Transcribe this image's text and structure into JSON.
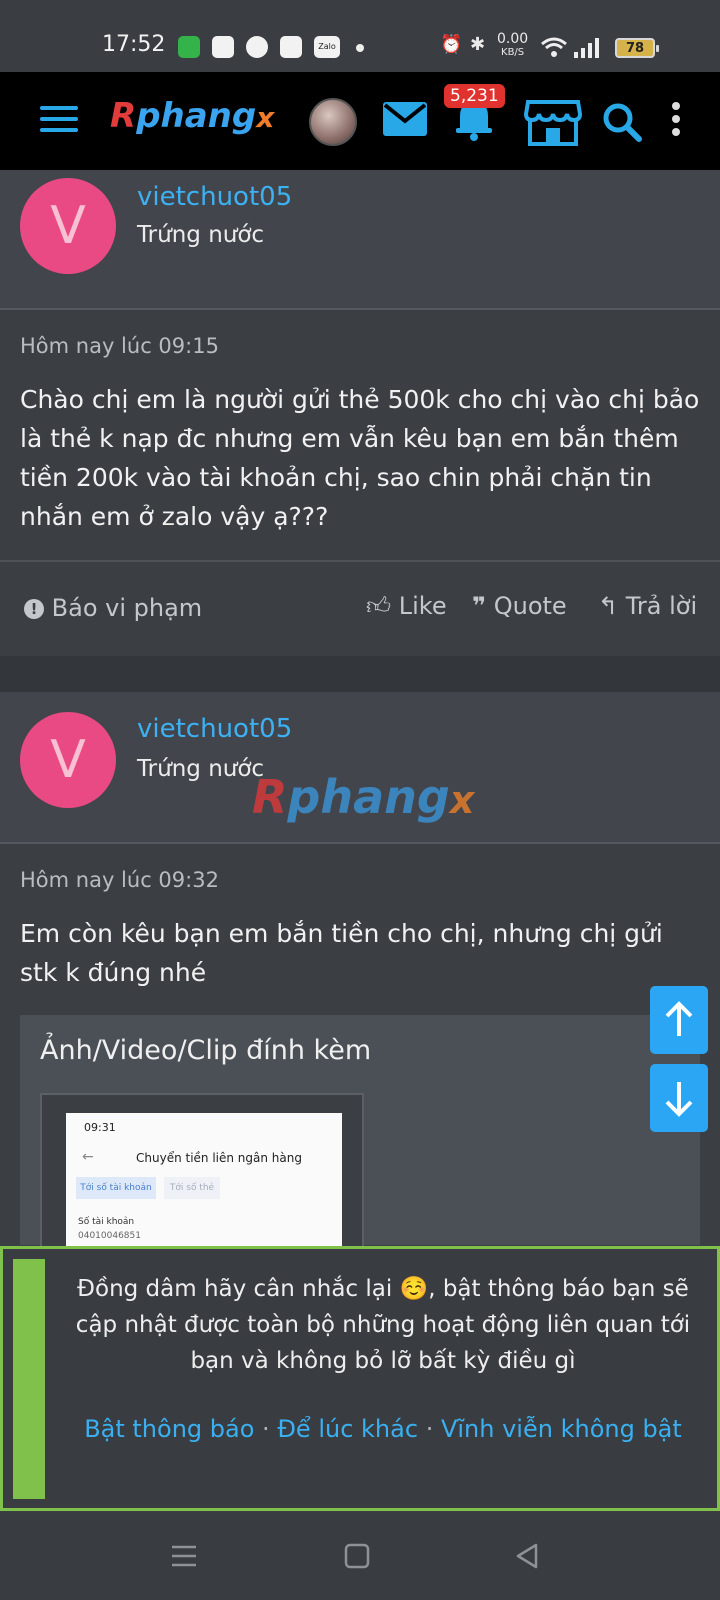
{
  "status_bar": {
    "time": "17:52",
    "net_speed": "0.00",
    "net_unit": "KB/S",
    "battery": "78",
    "icons": [
      "sms-icon",
      "shopee-icon",
      "facebook-icon",
      "photos-icon",
      "zalo-icon",
      "dot-icon",
      "alarm-icon",
      "bluetooth-icon",
      "wifi-icon",
      "signal-icon"
    ],
    "zalo_label": "Zalo"
  },
  "header": {
    "logo": {
      "r": "R",
      "p": "phang",
      "x": "x"
    },
    "notification_count": "5,231",
    "accent": "#29a8e8"
  },
  "posts": [
    {
      "avatar_letter": "V",
      "username": "vietchuot05",
      "user_title": "Trứng nước",
      "timestamp": "Hôm nay lúc 09:15",
      "message": "Chào chị em là người gửi thẻ 500k cho chị vào chị bảo là thẻ k nạp đc nhưng em vẫn kêu bạn em bắn thêm tiền 200k vào tài khoản chị, sao chin phải chặn tin nhắn em ở zalo vậy ạ???",
      "actions": {
        "report": "Báo vi phạm",
        "like": "Like",
        "quote": "Quote",
        "reply": "Trả lời"
      }
    },
    {
      "avatar_letter": "V",
      "username": "vietchuot05",
      "user_title": "Trứng nước",
      "timestamp": "Hôm nay lúc 09:32",
      "message": "Em còn kêu bạn em bắn tiền cho chị, nhưng chị gửi stk k đúng nhé",
      "attachment": {
        "title": "Ảnh/Video/Clip đính kèm",
        "thumb_time": "09:31",
        "thumb_title": "Chuyển tiền liên ngân hàng",
        "thumb_tab_1": "Tới số tài khoản",
        "thumb_tab_2": "Tới số thẻ",
        "thumb_field_label": "Số tài khoản",
        "thumb_field_value": "04010046851"
      }
    }
  ],
  "watermark": {
    "r": "R",
    "p": "phang",
    "x": "x"
  },
  "notification_prompt": {
    "text": "Đồng dâm hãy cân nhắc lại ☺️, bật thông báo bạn sẽ cập nhật được toàn bộ những hoạt động liên quan tới bạn và không bỏ lỡ bất kỳ điều gì",
    "enable": "Bật thông báo",
    "later": "Để lúc khác",
    "never": "Vĩnh viễn không bật",
    "separator": "·"
  }
}
